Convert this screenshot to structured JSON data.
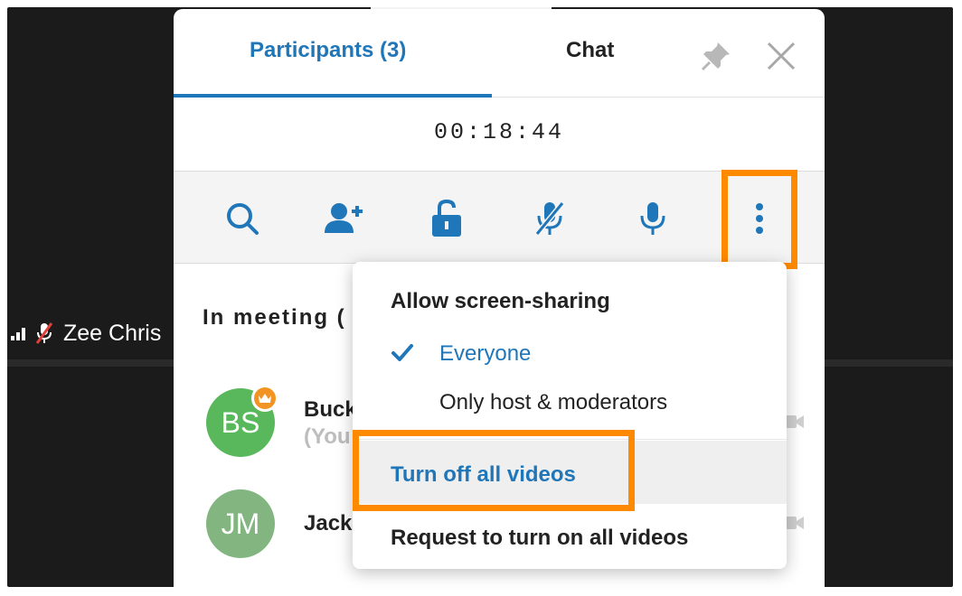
{
  "background_video": {
    "participant_label": "Zee Chris",
    "signal_icon": "signal-bars-icon",
    "mic_icon": "mic-muted-icon"
  },
  "panel": {
    "tabs": {
      "participants": "Participants (3)",
      "chat": "Chat",
      "active": "participants"
    },
    "pin_icon": "pin-icon",
    "close_icon": "close-icon",
    "timer": "00:18:44",
    "toolbar": {
      "items": [
        "search-icon",
        "add-participant-icon",
        "unlock-icon",
        "mute-all-icon",
        "microphone-icon",
        "more-options-icon"
      ]
    },
    "list": {
      "section_title": "In meeting (",
      "participants": [
        {
          "initials": "BS",
          "name": "Buck",
          "subtitle": "(You",
          "avatar_color": "#58b85b",
          "is_host": true
        },
        {
          "initials": "JM",
          "name": "Jack",
          "avatar_color": "#82b57f",
          "is_host": false
        }
      ]
    }
  },
  "menu": {
    "title": "Allow screen-sharing",
    "options": [
      {
        "label": "Everyone",
        "selected": true
      },
      {
        "label": "Only host & moderators",
        "selected": false
      }
    ],
    "turn_off_label": "Turn off all videos",
    "request_label": "Request to turn on all videos"
  },
  "colors": {
    "accent_blue": "#1f76b8",
    "highlight_orange": "#ff8a00",
    "host_badge": "#f29423"
  }
}
